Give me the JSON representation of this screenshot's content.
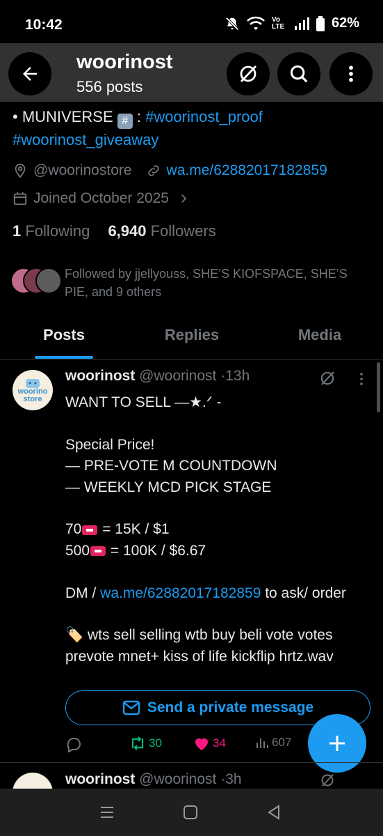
{
  "status_bar": {
    "time": "10:42",
    "volte": "Vo LTE",
    "battery": "62%"
  },
  "header": {
    "title": "woorinost",
    "subtitle": "556 posts"
  },
  "profile": {
    "bio_prefix": "• MUNIVERSE ",
    "bio_sep": " : ",
    "hashtag_proof": "#woorinost_proof",
    "hashtag_giveaway": "#woorinost_giveaway",
    "location": "@woorinostore",
    "website": "wa.me/62882017182859",
    "joined": "Joined October 2025",
    "following_count": "1",
    "following_label": "Following",
    "followers_count": "6,940",
    "followers_label": "Followers",
    "followed_by": "Followed by jjellyouss, SHE’S KIOFSPACE, SHE’S PIE, and 9 others"
  },
  "tabs": [
    {
      "label": "Posts",
      "active": true
    },
    {
      "label": "Replies",
      "active": false
    },
    {
      "label": "Media",
      "active": false
    }
  ],
  "posts": [
    {
      "avatar_text_1": "woorino",
      "avatar_text_2": "store",
      "name": "woorinost",
      "handle": "@woorinost",
      "sep": "·",
      "time": "13h",
      "line_title": "WANT TO SELL —★.ᐟ -",
      "line_special": "Special Price!",
      "line_item1": "— PRE-VOTE M COUNTDOWN",
      "line_item2": "— WEEKLY MCD PICK STAGE",
      "price1_qty": "70",
      "price1_rest": " = 15K / $1",
      "price2_qty": "500",
      "price2_rest": " = 100K / $6.67",
      "dm_prefix": "DM / ",
      "dm_link": "wa.me/62882017182859",
      "dm_suffix": " to ask/ order",
      "tag_emoji": "🏷️",
      "tags": " wts sell selling wtb buy beli vote votes prevote mnet+ kiss of life kickflip hrtz.wav",
      "dm_button": "Send a private message",
      "reposts": "30",
      "likes": "34",
      "views": "607"
    },
    {
      "name": "woorinost",
      "handle": "@woorinost",
      "sep": "·",
      "time": "3h"
    }
  ],
  "colors": {
    "accent": "#1d9bf0",
    "repost": "#00ba7c",
    "like": "#f91880",
    "muted": "#71767b"
  }
}
